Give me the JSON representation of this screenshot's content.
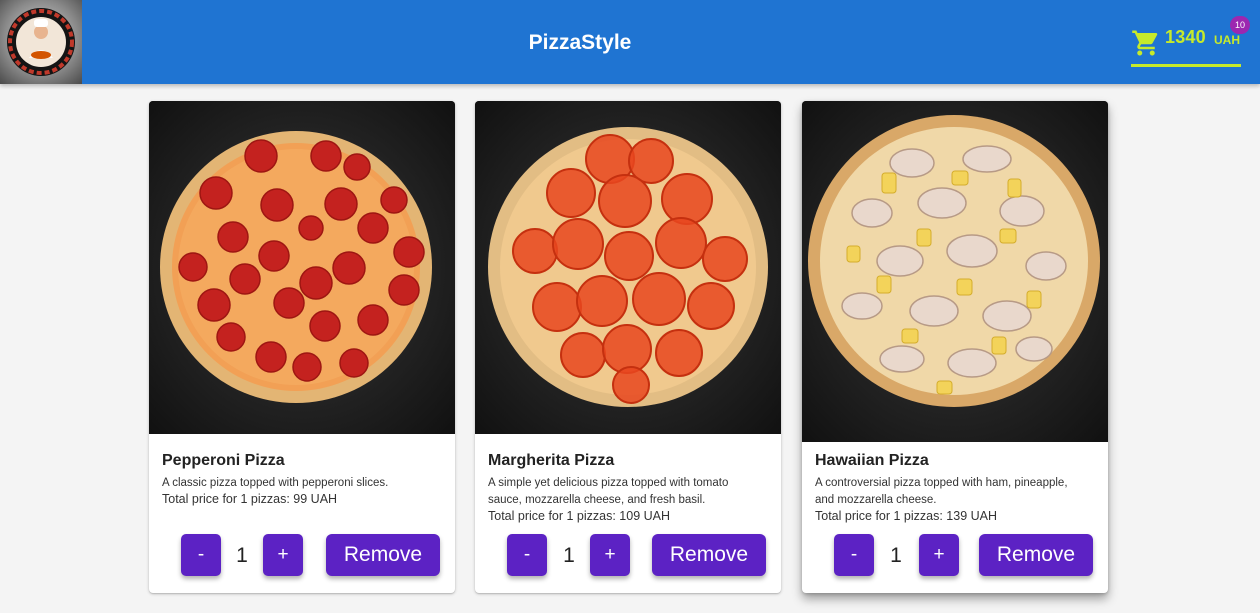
{
  "header": {
    "brand": "PizzaStyle",
    "cart_total": "1340",
    "cart_currency": "UAH",
    "cart_count": "10",
    "colors": {
      "bar": "#1f74d2",
      "cart_accent": "#c6ea2b",
      "badge": "#9c27b0"
    }
  },
  "cards": [
    {
      "name": "Pepperoni Pizza",
      "description": "A classic pizza topped with pepperoni slices.",
      "price_text": "Total price for 1 pizzas: 99 UAH",
      "quantity": "1",
      "minus_label": "-",
      "plus_label": "+",
      "remove_label": "Remove"
    },
    {
      "name": "Margherita Pizza",
      "description": "A simple yet delicious pizza topped with tomato sauce, mozzarella cheese, and fresh basil.",
      "price_text": "Total price for 1 pizzas: 109 UAH",
      "quantity": "1",
      "minus_label": "-",
      "plus_label": "+",
      "remove_label": "Remove"
    },
    {
      "name": "Hawaiian Pizza",
      "description": "A controversial pizza topped with ham, pineapple, and mozzarella cheese.",
      "price_text": "Total price for 1 pizzas: 139 UAH",
      "quantity": "1",
      "minus_label": "-",
      "plus_label": "+",
      "remove_label": "Remove"
    }
  ],
  "icons": {
    "cart": "shopping-cart-icon",
    "logo": "chef-logo-icon"
  },
  "accent_button_color": "#5c22c4"
}
